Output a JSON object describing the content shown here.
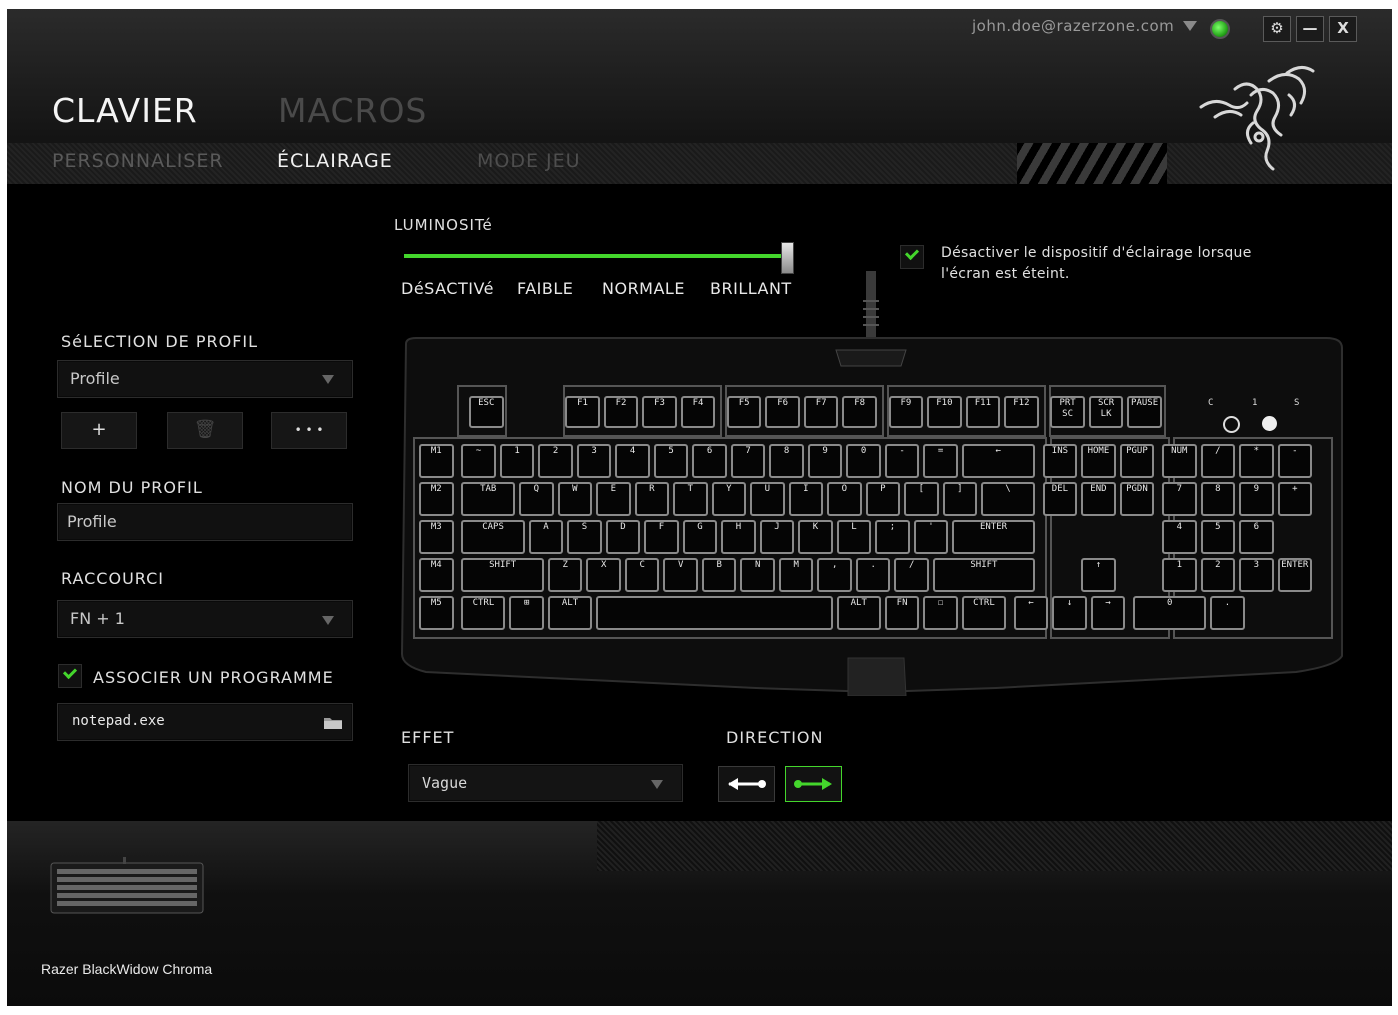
{
  "header": {
    "account_email": "john.doe@razerzone.com",
    "window_buttons": {
      "settings": "⚙",
      "minimize": "—",
      "close": "X"
    },
    "main_tabs": [
      {
        "label": "CLAVIER"
      },
      {
        "label": "MACROS"
      }
    ],
    "sub_tabs": [
      {
        "label": "PERSONNALISER"
      },
      {
        "label": "ÉCLAIRAGE"
      },
      {
        "label": "MODE JEU"
      }
    ]
  },
  "profile": {
    "selection_label": "SéLECTION DE PROFIL",
    "selected": "Profile",
    "add_label": "+",
    "delete_label": "🗑",
    "more_label": "• • •",
    "name_label": "NOM DU PROFIL",
    "name_value": "Profile",
    "shortcut_label": "RACCOURCI",
    "shortcut_value": "FN + 1",
    "associate_label": "ASSOCIER UN PROGRAMME",
    "associate_checked": true,
    "program_value": "notepad.exe"
  },
  "lighting": {
    "brightness_label": "LUMINOSITé",
    "brightness_level": "BRILLANT",
    "levels": [
      "DéSACTIVé",
      "FAIBLE",
      "NORMALE",
      "BRILLANT"
    ],
    "screen_off_label": "Désactiver le dispositif d'éclairage lorsque l'écran est éteint.",
    "screen_off_checked": true,
    "effect_label": "EFFET",
    "effect_value": "Vague",
    "direction_label": "DIRECTION",
    "direction_selected": "right",
    "accent_color": "#44d62c"
  },
  "keyboard": {
    "row1": [
      "ESC",
      "F1",
      "F2",
      "F3",
      "F4",
      "F5",
      "F6",
      "F7",
      "F8",
      "F9",
      "F10",
      "F11",
      "F12",
      "PRT SC",
      "SCR LK",
      "PAUSE"
    ],
    "row2": [
      "M1",
      "~",
      "1",
      "2",
      "3",
      "4",
      "5",
      "6",
      "7",
      "8",
      "9",
      "0",
      "-",
      "=",
      "←",
      "INS",
      "HOME",
      "PGUP",
      "NUM",
      "/",
      "*",
      "-"
    ],
    "row3": [
      "M2",
      "TAB",
      "Q",
      "W",
      "E",
      "R",
      "T",
      "Y",
      "U",
      "I",
      "O",
      "P",
      "[",
      "]",
      "\\",
      "DEL",
      "END",
      "PGDN",
      "7",
      "8",
      "9",
      "+"
    ],
    "row4": [
      "M3",
      "CAPS",
      "A",
      "S",
      "D",
      "F",
      "G",
      "H",
      "J",
      "K",
      "L",
      ";",
      "'",
      "ENTER",
      "4",
      "5",
      "6"
    ],
    "row5": [
      "M4",
      "SHIFT",
      "Z",
      "X",
      "C",
      "V",
      "B",
      "N",
      "M",
      ",",
      ".",
      "/",
      "SHIFT",
      "↑",
      "1",
      "2",
      "3",
      "ENTER"
    ],
    "row6": [
      "M5",
      "CTRL",
      "⊞",
      "ALT",
      "",
      "ALT",
      "FN",
      "☐",
      "CTRL",
      "←",
      "↓",
      "→",
      "0",
      "."
    ],
    "leds": [
      "C",
      "1",
      "S"
    ]
  },
  "footer": {
    "device_name": "Razer BlackWidow Chroma"
  }
}
